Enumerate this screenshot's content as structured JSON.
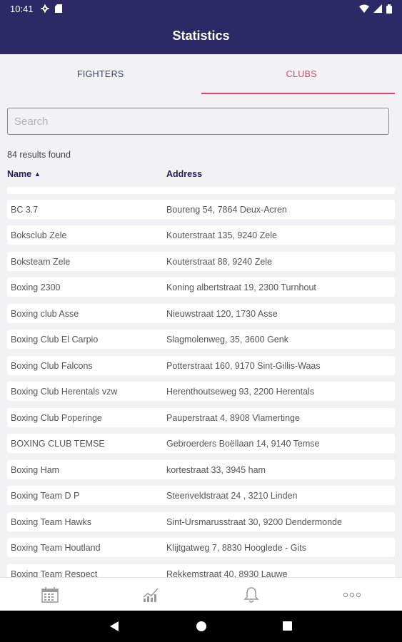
{
  "status_bar": {
    "time": "10:41"
  },
  "app_bar": {
    "title": "Statistics"
  },
  "tabs": [
    {
      "label": "FIGHTERS",
      "active": false
    },
    {
      "label": "CLUBS",
      "active": true
    }
  ],
  "search": {
    "placeholder": "Search",
    "value": ""
  },
  "results_text": "84 results found",
  "columns": {
    "name": "Name",
    "address": "Address",
    "sort": "ascending"
  },
  "colors": {
    "primary": "#2c2966",
    "accent": "#e5406a",
    "background": "#f2f2f5"
  },
  "clubs": [
    {
      "name": "BC 3.7",
      "address": "Boureng 54, 7864 Deux-Acren"
    },
    {
      "name": "Boksclub Zele",
      "address": "Kouterstraat 135, 9240 Zele"
    },
    {
      "name": "Boksteam Zele",
      "address": "Kouterstraat 88, 9240 Zele"
    },
    {
      "name": "Boxing 2300",
      "address": "Koning albertstraat 19, 2300 Turnhout"
    },
    {
      "name": "Boxing club Asse",
      "address": "Nieuwstraat 120, 1730 Asse"
    },
    {
      "name": "Boxing Club El Carpio",
      "address": "Slagmolenweg, 35, 3600 Genk"
    },
    {
      "name": "Boxing Club Falcons",
      "address": "Potterstraat 160, 9170 Sint-Gillis-Waas"
    },
    {
      "name": "Boxing Club Herentals vzw",
      "address": "Herenthoutseweg 93, 2200 Herentals"
    },
    {
      "name": "Boxing Club Poperinge",
      "address": "Pauperstraat 4, 8908 Vlamertinge"
    },
    {
      "name": "BOXING CLUB TEMSE",
      "address": "Gebroerders Boëllaan 14, 9140 Temse"
    },
    {
      "name": "Boxing Ham",
      "address": "kortestraat 33, 3945  ham"
    },
    {
      "name": "Boxing Team D P",
      "address": "Steenveldstraat 24 , 3210 Linden"
    },
    {
      "name": "Boxing Team Hawks",
      "address": "Sint-Ursmarusstraat 30, 9200 Dendermonde"
    },
    {
      "name": "Boxing Team Houtland",
      "address": "Klijtgatweg 7, 8830 Hooglede - Gits"
    },
    {
      "name": "Boxing Team Respect",
      "address": "Rekkemstraat 40, 8930 Lauwe"
    }
  ],
  "bottom_nav": [
    {
      "icon": "calendar-icon"
    },
    {
      "icon": "statistics-chart-icon"
    },
    {
      "icon": "bell-icon"
    },
    {
      "icon": "more-icon"
    }
  ]
}
